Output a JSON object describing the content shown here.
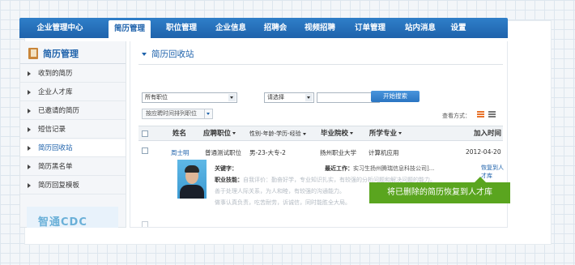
{
  "nav": {
    "items": [
      "企业管理中心",
      "简历管理",
      "职位管理",
      "企业信息",
      "招聘会",
      "视频招聘",
      "订单管理",
      "站内消息",
      "设置"
    ],
    "active": "简历管理"
  },
  "sidebar": {
    "title": "简历管理",
    "items": [
      "收到的简历",
      "企业人才库",
      "已邀请的简历",
      "短信记录",
      "简历回收站",
      "简历黑名单",
      "简历回复模板"
    ],
    "active": "简历回收站",
    "logo_text": "智通CDC"
  },
  "main": {
    "title": "简历回收站",
    "filter": {
      "position": "所有职位",
      "select": "请选择",
      "keyword": "",
      "search_label": "开始搜索",
      "sort_label": "按应聘时间排列职位"
    },
    "view_label": "查看方式："
  },
  "table": {
    "headers": {
      "name": "姓名",
      "position": "应聘职位",
      "info": "性别-年龄-学历-经验",
      "school": "毕业院校",
      "major": "所学专业",
      "date": "加入时间"
    },
    "row": {
      "name": "周士明",
      "position": "普通测试职位",
      "info": "男-23-大专-2",
      "school": "扬州职业大学",
      "major": "计算机应用",
      "date": "2012-04-20",
      "keyword_label": "关键字：",
      "recent_label": "最近工作：",
      "recent_value": "实习生扬州腾瑞信息科技公司]...",
      "skills_label": "职业技能：",
      "skills_text": "自我评价：勤奋好学，专业知识扎实，有较强的分析问题和解决问题的能力。",
      "line2": "善于处理人际关系，为人和睦，有较强的沟通能力。",
      "line3": "做事认真负责，吃苦耐劳，诉诚信，同时能胜全大局。",
      "restore_label": "恢复到人才库"
    }
  },
  "tooltip": "将已删除的简历恢复到人才库",
  "colors": {
    "nav_bg": "#1e62ab",
    "accent": "#1e62ab",
    "tooltip": "#5aa51f",
    "view_active": "#e8732b"
  },
  "icons": [
    "book-icon",
    "arrow-icon",
    "dropdown-icon",
    "list-view-icon",
    "grid-view-icon"
  ]
}
